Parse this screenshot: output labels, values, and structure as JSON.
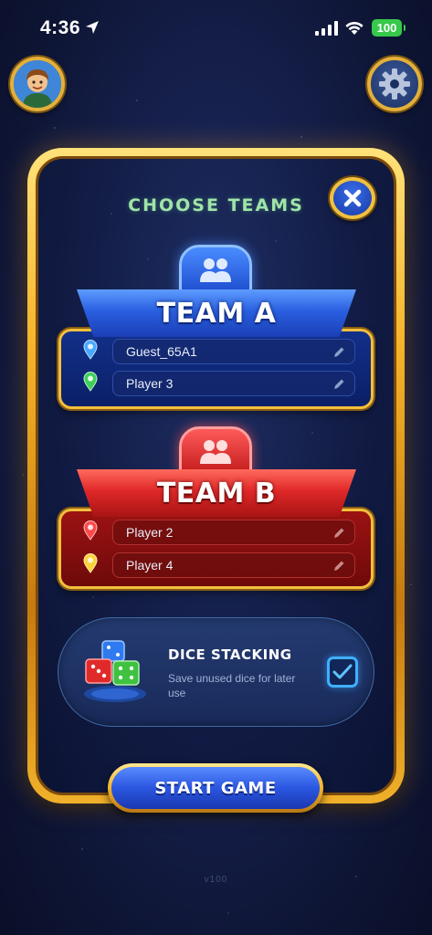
{
  "status_bar": {
    "time": "4:36",
    "battery": "100",
    "battery_color": "#37c94a"
  },
  "header": {
    "avatar_icon": "player-avatar-icon",
    "settings_icon": "gear-icon"
  },
  "panel": {
    "title": "CHOOSE TEAMS",
    "close_icon": "close-icon",
    "accent_gold": "#f3bf3d"
  },
  "teams": [
    {
      "name": "TEAM A",
      "color": "#2a5fe0",
      "icon": "team-people-icon",
      "players": [
        {
          "name": "Guest_65A1",
          "pin_color": "#4aa8ff"
        },
        {
          "name": "Player 3",
          "pin_color": "#3fcf5a"
        }
      ]
    },
    {
      "name": "TEAM B",
      "color": "#e02828",
      "icon": "team-people-icon",
      "players": [
        {
          "name": "Player 2",
          "pin_color": "#ff4a4a"
        },
        {
          "name": "Player 4",
          "pin_color": "#ffd23a"
        }
      ]
    }
  ],
  "dice_stacking": {
    "title": "DICE STACKING",
    "description": "Save unused dice for later use",
    "checked": true,
    "icon": "dice-stack-icon"
  },
  "start_button": {
    "label": "START GAME"
  },
  "version": "v100"
}
